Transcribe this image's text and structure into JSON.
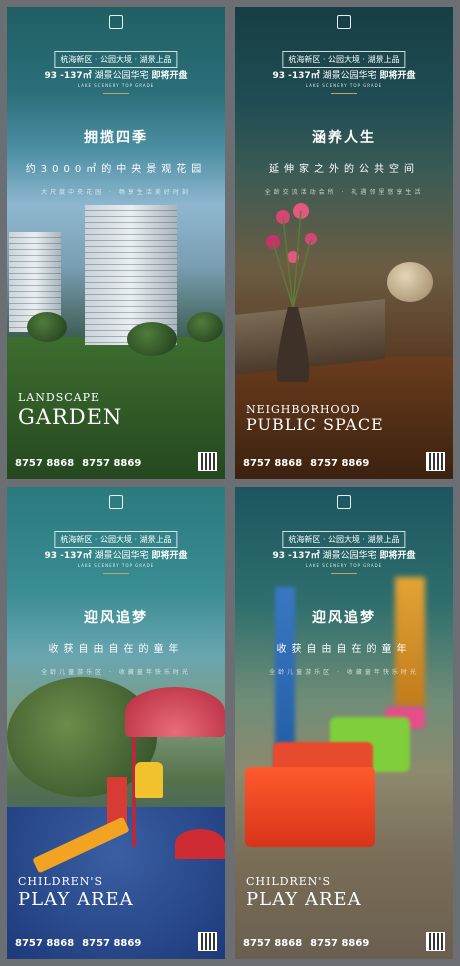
{
  "posters": [
    {
      "tag": "杭海新区 · 公园大境 · 湖景上品",
      "headline_prefix": "93 -137㎡",
      "headline_suffix": "湖景公园华宅",
      "headline_cta": "即将开盘",
      "sub_en": "LAKE SCENERY TOP GRADE",
      "title": "拥揽四季",
      "slogan": "约3000㎡的中央景观花园",
      "desc": "大尺度中央花园 · 畅享生活美好时刻",
      "en_line1": "LANDSCAPE",
      "en_line2": "GARDEN",
      "phone1": "8757 8868",
      "phone2": "8757 8869"
    },
    {
      "tag": "杭海新区 · 公园大境 · 湖景上品",
      "headline_prefix": "93 -137㎡",
      "headline_suffix": "湖景公园华宅",
      "headline_cta": "即将开盘",
      "sub_en": "LAKE SCENERY TOP GRADE",
      "title": "涵养人生",
      "slogan": "延伸家之外的公共空间",
      "desc": "全龄交流活动会所 · 礼遇邻里悠享生活",
      "en_line1": "NEIGHBORHOOD",
      "en_line2": "PUBLIC SPACE",
      "phone1": "8757 8868",
      "phone2": "8757 8869"
    },
    {
      "tag": "杭海新区 · 公园大境 · 湖景上品",
      "headline_prefix": "93 -137㎡",
      "headline_suffix": "湖景公园华宅",
      "headline_cta": "即将开盘",
      "sub_en": "LAKE SCENERY TOP GRADE",
      "title": "迎风追梦",
      "slogan": "收获自由自在的童年",
      "desc": "全龄儿童游乐区 · 收藏童年快乐时光",
      "en_line1": "CHILDREN'S",
      "en_line2": "PLAY AREA",
      "phone1": "8757 8868",
      "phone2": "8757 8869"
    },
    {
      "tag": "杭海新区 · 公园大境 · 湖景上品",
      "headline_prefix": "93 -137㎡",
      "headline_suffix": "湖景公园华宅",
      "headline_cta": "即将开盘",
      "sub_en": "LAKE SCENERY TOP GRADE",
      "title": "迎风追梦",
      "slogan": "收获自由自在的童年",
      "desc": "全龄儿童游乐区 · 收藏童年快乐时光",
      "en_line1": "CHILDREN'S",
      "en_line2": "PLAY AREA",
      "phone1": "8757 8868",
      "phone2": "8757 8869"
    }
  ],
  "colors": {
    "accent_gold": "#c9a55a",
    "background": "#6b6f73"
  }
}
